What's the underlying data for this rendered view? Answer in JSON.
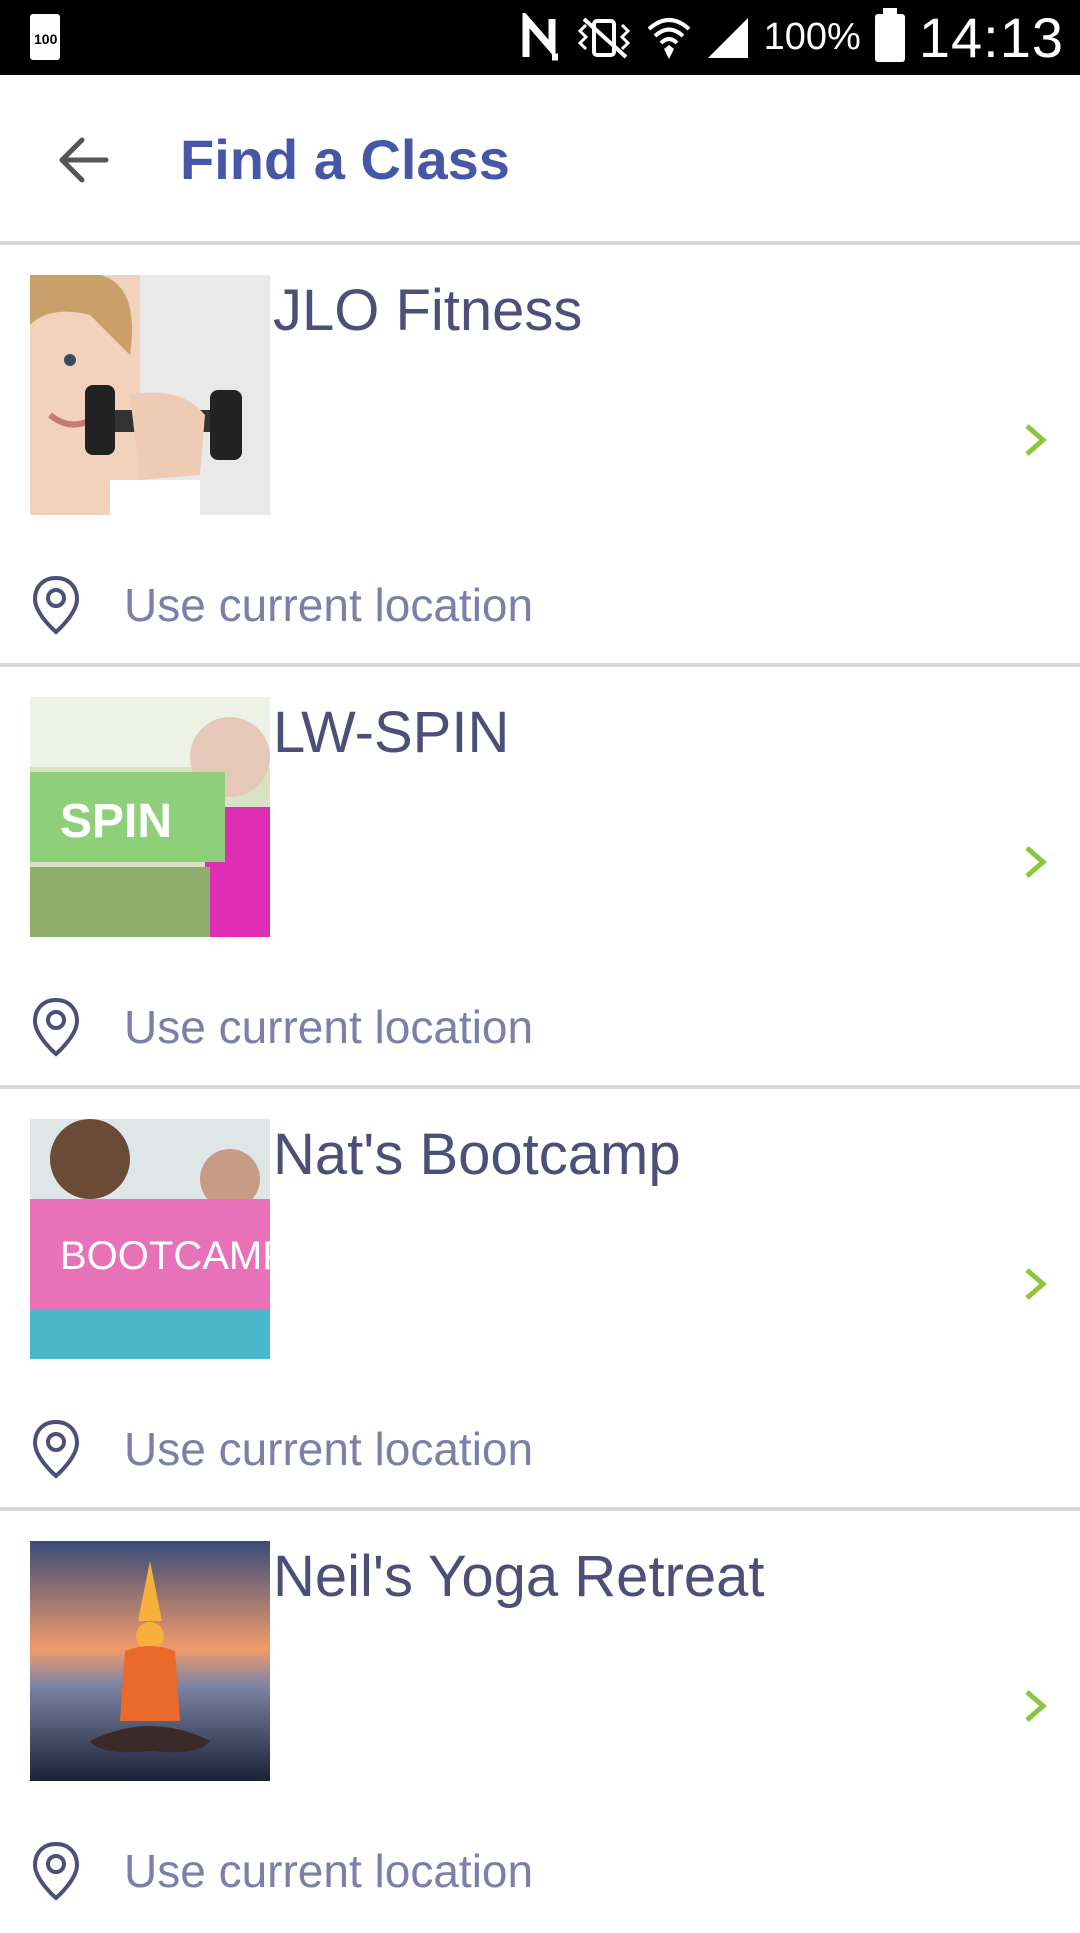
{
  "status_bar": {
    "battery_indicator": "100",
    "battery_percent": "100%",
    "time": "14:13",
    "icons": [
      "nfc-icon",
      "vibrate-icon",
      "wifi-icon",
      "signal-icon",
      "battery-icon"
    ]
  },
  "appbar": {
    "title": "Find a Class",
    "back_icon": "arrow-left-icon"
  },
  "classes": [
    {
      "name": "JLO Fitness",
      "location_label": "Use current location",
      "thumbnail": "dumbbell-woman-image"
    },
    {
      "name": "LW-SPIN",
      "location_label": "Use current location",
      "thumbnail": "spin-card-image",
      "thumbnail_text": "SPIN"
    },
    {
      "name": "Nat's Bootcamp",
      "location_label": "Use current location",
      "thumbnail": "bootcamp-card-image",
      "thumbnail_text": "BOOTCAMP"
    },
    {
      "name": "Neil's Yoga Retreat",
      "location_label": "Use current location",
      "thumbnail": "yoga-sunset-image"
    }
  ],
  "colors": {
    "title": "#4757a8",
    "item_text": "#4a5078",
    "location_text": "#7b80a8",
    "chevron": "#8cc63f",
    "divider": "#d8d8d8"
  }
}
